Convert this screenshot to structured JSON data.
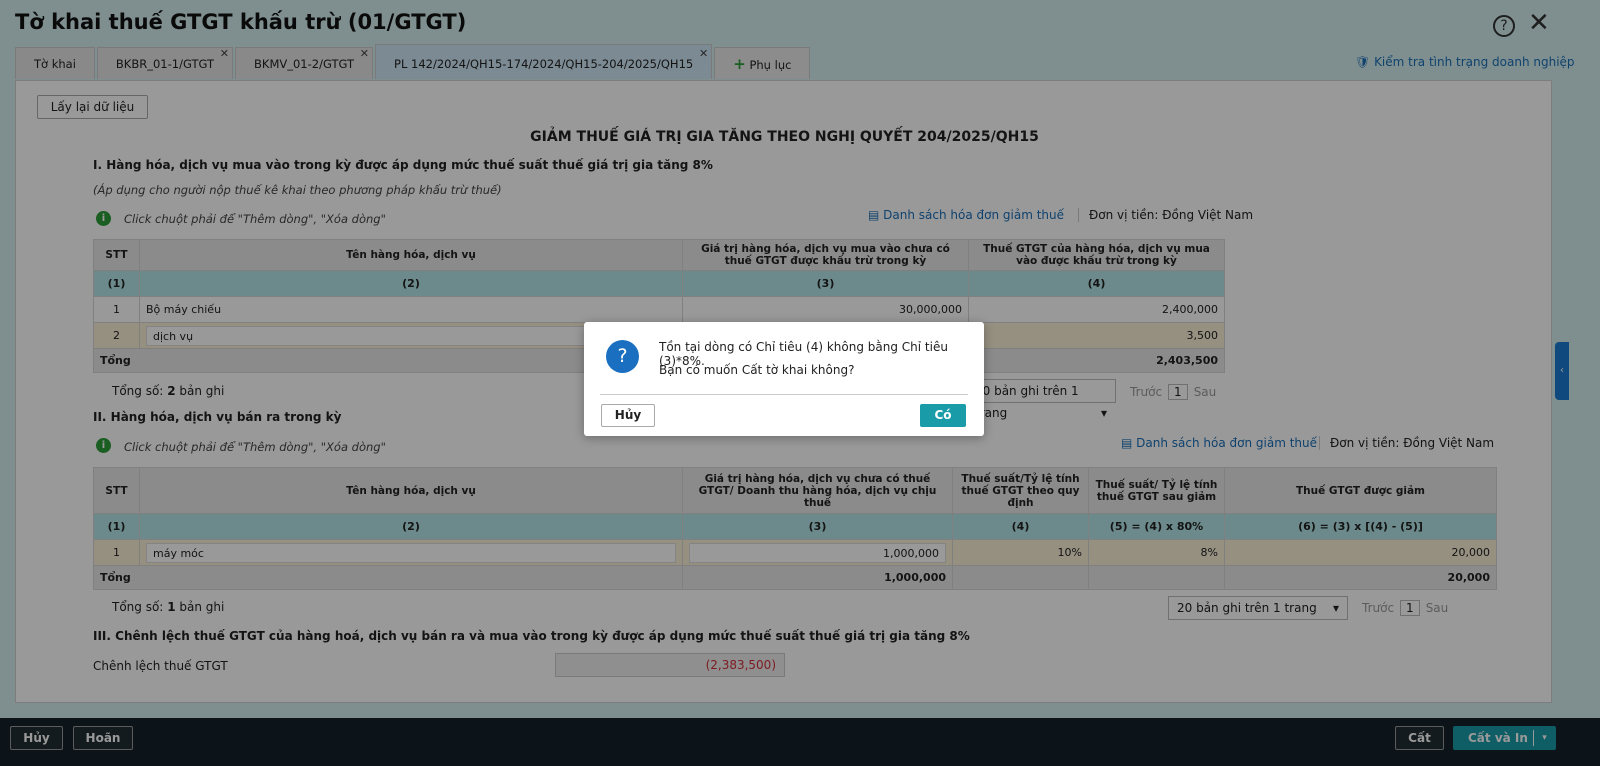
{
  "window": {
    "title": "Tờ khai thuế GTGT khấu trừ (01/GTGT)"
  },
  "tabs": [
    {
      "label": "Tờ khai"
    },
    {
      "label": "BKBR_01-1/GTGT"
    },
    {
      "label": "BKMV_01-2/GTGT"
    },
    {
      "label": "PL 142/2024/QH15-174/2024/QH15-204/2025/QH15"
    },
    {
      "label": "Phụ lục"
    }
  ],
  "check_link": "Kiểm tra tình trạng doanh nghiệp",
  "reload_button": "Lấy lại dữ liệu",
  "heading": "GIẢM THUẾ GIÁ TRỊ GIA TĂNG THEO NGHỊ QUYẾT 204/2025/QH15",
  "section1": {
    "title": "I. Hàng hóa, dịch vụ mua vào trong kỳ được áp dụng mức thuế suất thuế giá trị gia tăng 8%",
    "note": "(Áp dụng cho người nộp thuế kê khai theo phương pháp khấu trừ thuế)",
    "hint": "Click chuột phải để \"Thêm dòng\", \"Xóa dòng\"",
    "invoice_link": "Danh sách hóa đơn giảm thuế",
    "currency": "Đơn vị tiền: Đồng Việt Nam",
    "headers": [
      "STT",
      "Tên hàng hóa, dịch vụ",
      "Giá trị hàng hóa, dịch vụ mua vào chưa có thuế GTGT được khấu trừ trong kỳ",
      "Thuế GTGT của hàng hóa, dịch vụ mua vào được khấu trừ trong kỳ"
    ],
    "codes": [
      "(1)",
      "(2)",
      "(3)",
      "(4)"
    ],
    "rows": [
      [
        "1",
        "Bộ máy chiếu",
        "30,000,000",
        "2,400,000"
      ],
      [
        "2",
        "dịch vụ",
        "",
        "3,500"
      ]
    ],
    "total": {
      "label": "Tổng",
      "c4": "2,403,500"
    },
    "count_label": "Tổng số:",
    "count": "2",
    "count_unit": "bản ghi",
    "page_size": "20 bản ghi trên 1 trang",
    "prev": "Trước",
    "page": "1",
    "next": "Sau"
  },
  "section2": {
    "title": "II. Hàng hóa, dịch vụ bán ra trong kỳ",
    "hint": "Click chuột phải để \"Thêm dòng\", \"Xóa dòng\"",
    "invoice_link": "Danh sách hóa đơn giảm thuế",
    "currency": "Đơn vị tiền: Đồng Việt Nam",
    "headers": [
      "STT",
      "Tên hàng hóa, dịch vụ",
      "Giá trị hàng hóa, dịch vụ chưa có thuế GTGT/ Doanh thu hàng hóa, dịch vụ chịu thuế",
      "Thuế suất/Tỷ lệ tính thuế GTGT theo quy định",
      "Thuế suất/ Tỷ lệ tính thuế GTGT sau giảm",
      "Thuế GTGT được giảm"
    ],
    "codes": [
      "(1)",
      "(2)",
      "(3)",
      "(4)",
      "(5) = (4) x 80%",
      "(6) = (3) x [(4) - (5)]"
    ],
    "rows": [
      [
        "1",
        "máy móc",
        "1,000,000",
        "10%",
        "8%",
        "20,000"
      ]
    ],
    "total": {
      "label": "Tổng",
      "c3": "1,000,000",
      "c6": "20,000"
    },
    "count_label": "Tổng số:",
    "count": "1",
    "count_unit": "bản ghi",
    "page_size": "20 bản ghi trên 1 trang",
    "prev": "Trước",
    "page": "1",
    "next": "Sau"
  },
  "section3": {
    "title": "III. Chênh lệch thuế GTGT của hàng hoá, dịch vụ bán ra và mua vào trong kỳ được áp dụng mức thuế suất thuế giá trị gia tăng 8%",
    "label": "Chênh lệch thuế GTGT",
    "value": "(2,383,500)"
  },
  "footer": {
    "cancel": "Hủy",
    "undo": "Hoãn",
    "save": "Cất",
    "save_print": "Cất và In"
  },
  "dialog": {
    "line1": "Tồn tại dòng có Chỉ tiêu (4) không bằng Chỉ tiêu (3)*8%.",
    "line2": "Bạn có muốn Cất tờ khai không?",
    "cancel": "Hủy",
    "ok": "Có"
  },
  "colors": {
    "accent": "#1a9ba8",
    "link": "#1a6fb8",
    "negative": "#d0313a"
  }
}
